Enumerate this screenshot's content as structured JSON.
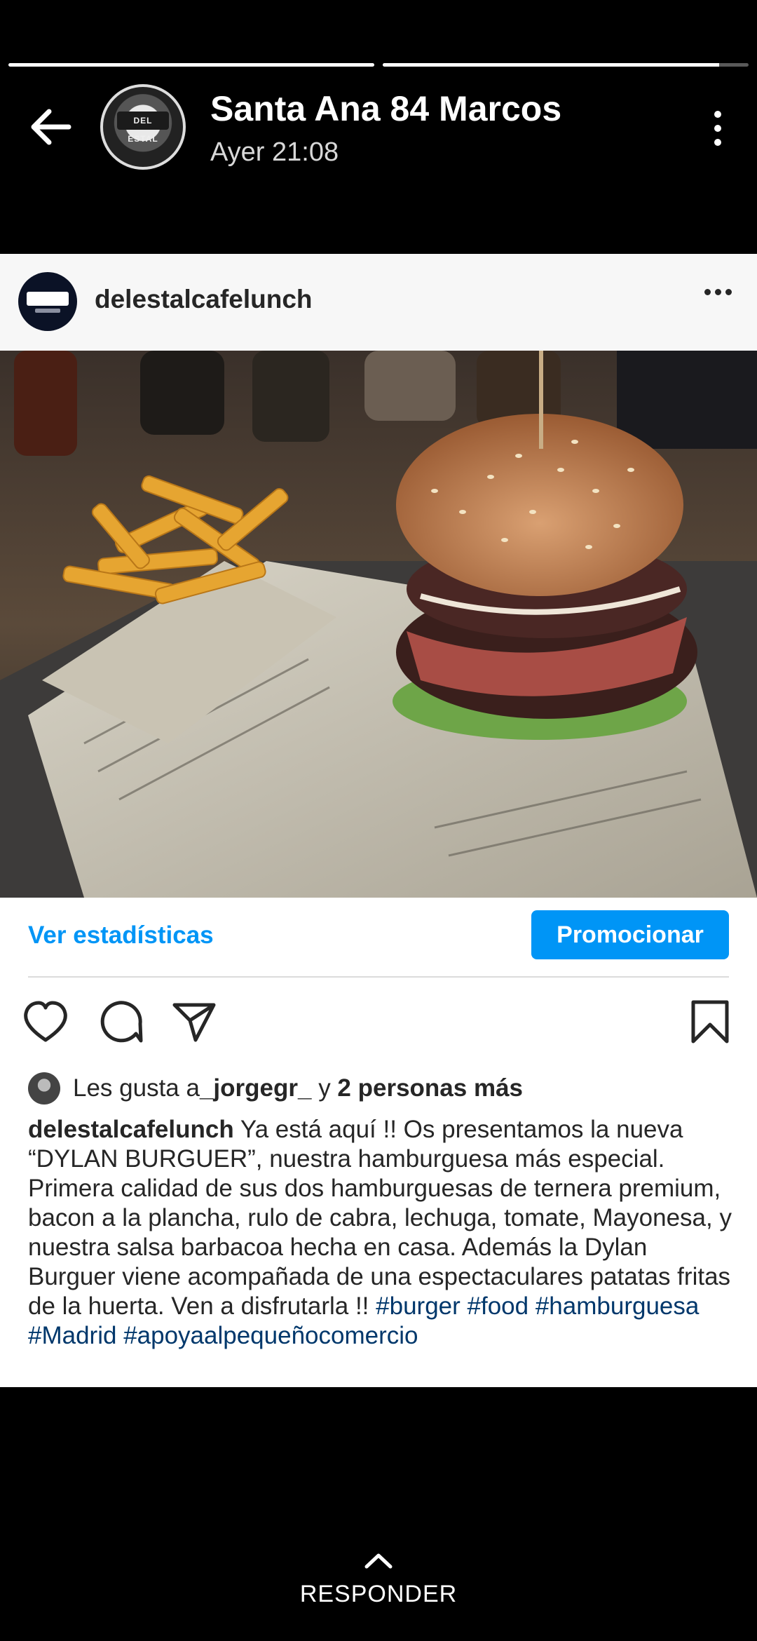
{
  "story": {
    "title": "Santa Ana 84 Marcos",
    "time": "Ayer 21:08",
    "progress": [
      1.0,
      0.92
    ]
  },
  "post": {
    "username": "delestalcafelunch",
    "stats_link": "Ver estadísticas",
    "promote_label": "Promocionar",
    "likes": {
      "prefix": "Les gusta a ",
      "user": "_jorgegr_",
      "middle": " y ",
      "others": "2 personas más"
    },
    "caption": {
      "user": "delestalcafelunch",
      "text": " Ya está aquí !! Os presentamos la nueva “DYLAN BURGUER”, nuestra hamburguesa más especial. Primera calidad de sus dos hamburguesas de ternera premium, bacon a la plancha, rulo de cabra, lechuga, tomate, Mayonesa, y nuestra salsa barbacoa hecha en casa. Además la Dylan Burguer viene acompañada de una espectaculares patatas fritas de la huerta. Ven a disfrutarla !! ",
      "hashtags": [
        "#burger",
        "#food",
        "#hamburguesa",
        "#Madrid",
        "#apoyaalpequeñocomercio"
      ]
    }
  },
  "reply_label": "RESPONDER",
  "colors": {
    "accent": "#0095f6",
    "hashtag": "#00376b",
    "text": "#262626"
  }
}
